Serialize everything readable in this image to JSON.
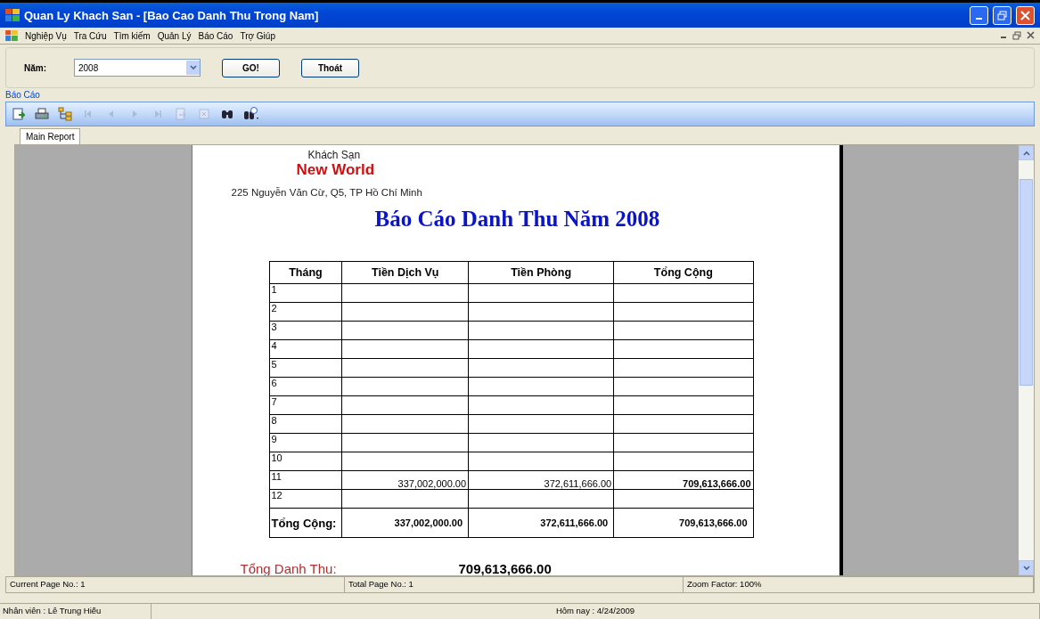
{
  "window": {
    "title": "Quan Ly Khach San - [Bao Cao Danh Thu Trong Nam]"
  },
  "menu": [
    "Nghiệp Vụ",
    "Tra Cứu",
    "Tìm kiếm",
    "Quản Lý",
    "Báo Cáo",
    "Trợ Giúp"
  ],
  "filter": {
    "label": "Năm:",
    "year": "2008",
    "buttons": [
      "GO!",
      "Thoát"
    ]
  },
  "group_label": "Báo Cáo",
  "toolbar": [
    {
      "kind": "export",
      "disabled": false
    },
    {
      "kind": "print",
      "disabled": false
    },
    {
      "kind": "tree",
      "disabled": false
    },
    {
      "kind": "first",
      "disabled": true
    },
    {
      "kind": "prev",
      "disabled": true
    },
    {
      "kind": "next",
      "disabled": true
    },
    {
      "kind": "last",
      "disabled": true
    },
    {
      "kind": "goto",
      "disabled": true
    },
    {
      "kind": "stop",
      "disabled": true
    },
    {
      "kind": "search",
      "disabled": false
    },
    {
      "kind": "zoom",
      "disabled": false
    }
  ],
  "tabs": [
    {
      "label": "Main Report",
      "selected": true
    }
  ],
  "report": {
    "hotel_label": "Khách Sạn",
    "hotel_name": "New World",
    "address": "225 Nguyễn Văn Cừ, Q5, TP Hồ Chí Minh",
    "title": "Báo Cáo Danh Thu Năm 2008",
    "columns": [
      "Tháng",
      "Tiền Dịch Vụ",
      "Tiền Phòng",
      "Tổng Cộng"
    ],
    "rows": [
      {
        "month": "1"
      },
      {
        "month": "2"
      },
      {
        "month": "3"
      },
      {
        "month": "4"
      },
      {
        "month": "5"
      },
      {
        "month": "6"
      },
      {
        "month": "7"
      },
      {
        "month": "8"
      },
      {
        "month": "9"
      },
      {
        "month": "10"
      },
      {
        "month": "11",
        "values": [
          "337,002,000.00",
          "372,611,666.00",
          "709,613,666.00"
        ]
      },
      {
        "month": "12"
      }
    ],
    "total_row": {
      "label": "Tổng Cộng:",
      "values": [
        "337,002,000.00",
        "372,611,666.00",
        "709,613,666.00"
      ]
    },
    "summary": {
      "label": "Tổng Danh Thu:",
      "value": "709,613,666.00"
    }
  },
  "viewer_status": [
    "Current Page No.: 1",
    "Total Page No.: 1",
    "Zoom Factor: 100%"
  ],
  "status_bar": [
    "Nhân viên : Lê Trung Hiếu",
    "Hôm nay : 4/24/2009"
  ]
}
